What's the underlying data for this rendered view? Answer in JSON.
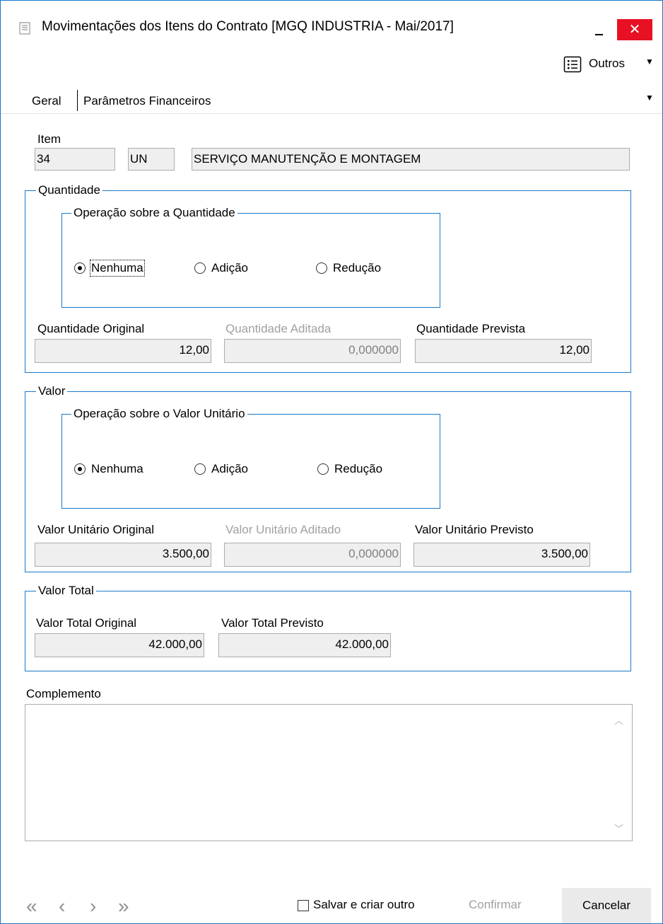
{
  "window": {
    "title": "Movimentações dos Itens do Contrato [MGQ INDUSTRIA - Mai/2017]",
    "minimize": "–",
    "close": "✕"
  },
  "toolbar": {
    "outros": "Outros",
    "outros_caret": "▼"
  },
  "tabs": {
    "geral": "Geral",
    "parametros": "Parâmetros Financeiros",
    "overflow": "▼"
  },
  "item": {
    "label": "Item",
    "code": "34",
    "unit": "UN",
    "description": "SERVIÇO MANUTENÇÃO E MONTAGEM"
  },
  "quantidade": {
    "legend": "Quantidade",
    "op_legend": "Operação sobre a Quantidade",
    "options": [
      "Nenhuma",
      "Adição",
      "Redução"
    ],
    "selected": "Nenhuma",
    "original_label": "Quantidade Original",
    "original_value": "12,00",
    "aditada_label": "Quantidade Aditada",
    "aditada_value": "0,000000",
    "prevista_label": "Quantidade Prevista",
    "prevista_value": "12,00"
  },
  "valor": {
    "legend": "Valor",
    "op_legend": "Operação sobre o Valor Unitário",
    "options": [
      "Nenhuma",
      "Adição",
      "Redução"
    ],
    "selected": "Nenhuma",
    "original_label": "Valor Unitário Original",
    "original_value": "3.500,00",
    "aditado_label": "Valor Unitário Aditado",
    "aditado_value": "0,000000",
    "previsto_label": "Valor Unitário Previsto",
    "previsto_value": "3.500,00"
  },
  "valor_total": {
    "legend": "Valor Total",
    "original_label": "Valor Total Original",
    "original_value": "42.000,00",
    "previsto_label": "Valor Total Previsto",
    "previsto_value": "42.000,00"
  },
  "complemento": {
    "label": "Complemento",
    "value": ""
  },
  "footer": {
    "first": "«",
    "prev": "‹",
    "next": "›",
    "last": "»",
    "salvar_criar": "Salvar e criar outro",
    "salvar_criar_checked": false,
    "confirmar": "Confirmar",
    "cancelar": "Cancelar"
  }
}
